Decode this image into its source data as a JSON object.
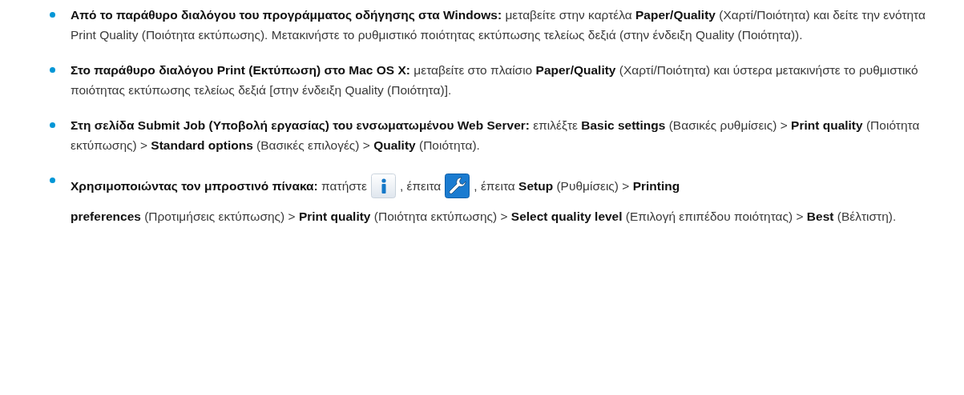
{
  "items": [
    {
      "segments": [
        {
          "kind": "text",
          "text": "**Από το παράθυρο διαλόγου του προγράμματος οδήγησης στα Windows:** μεταβείτε στην καρτέλα **Paper/Quality** (Χαρτί/Ποιότητα) και δείτε την ενότητα Print Quality (Ποιότητα εκτύπωσης). Μετακινήστε το ρυθμιστικό ποιότητας εκτύπωσης τελείως δεξιά (στην ένδειξη Quality (Ποιότητα))."
        }
      ]
    },
    {
      "segments": [
        {
          "kind": "text",
          "text": "**Στο παράθυρο διαλόγου Print (Εκτύπωση) στο Mac OS X:** μεταβείτε στο πλαίσιο **Paper/Quality** (Χαρτί/Ποιότητα) και ύστερα μετακινήστε το ρυθμιστικό ποιότητας εκτύπωσης τελείως δεξιά [στην ένδειξη Quality (Ποιότητα)]."
        }
      ]
    },
    {
      "segments": [
        {
          "kind": "text",
          "text": "**Στη σελίδα Submit Job (Υποβολή εργασίας) του ενσωματωμένου Web Server:** επιλέξτε **Basic settings** (Βασικές ρυθμίσεις) > **Print quality** (Ποιότητα εκτύπωσης) > **Standard options** (Βασικές επιλογές) > **Quality** (Ποιότητα)."
        }
      ]
    },
    {
      "segments": [
        {
          "kind": "text",
          "text": "**Χρησιμοποιώντας τον μπροστινό πίνακα:** πατήστε"
        },
        {
          "kind": "info"
        },
        {
          "kind": "text",
          "text": ", έπειτα"
        },
        {
          "kind": "wrench"
        },
        {
          "kind": "text",
          "text": ", έπειτα **Setup** (Ρυθμίσεις) > **Printing**"
        },
        {
          "kind": "newline"
        },
        {
          "kind": "text",
          "text": "**preferences** (Προτιμήσεις εκτύπωσης) > **Print quality** (Ποιότητα εκτύπωσης) > **Select quality level** (Επιλογή επιπέδου ποιότητας) > **Best** (Βέλτιστη)."
        }
      ]
    }
  ]
}
